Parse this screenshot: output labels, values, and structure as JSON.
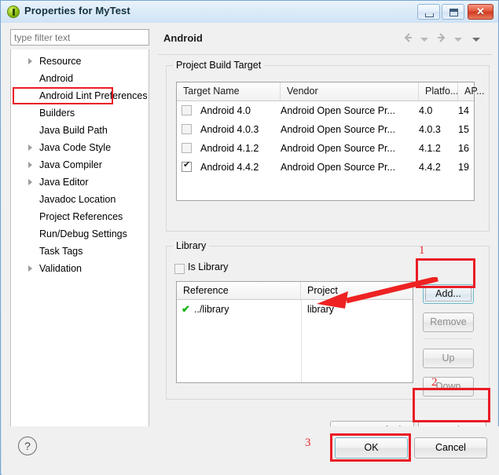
{
  "window": {
    "title": "Properties for MyTest",
    "icon": "eclipse-properties-icon",
    "controls": {
      "minimize": "minimize-icon",
      "maximize": "maximize-icon",
      "close": "✕"
    }
  },
  "sidebar": {
    "filter": {
      "placeholder": "type filter text",
      "value": ""
    },
    "items": [
      {
        "label": "Resource",
        "expandable": true
      },
      {
        "label": "Android",
        "expandable": false,
        "highlighted": true
      },
      {
        "label": "Android Lint Preferences",
        "expandable": false
      },
      {
        "label": "Builders",
        "expandable": false
      },
      {
        "label": "Java Build Path",
        "expandable": false
      },
      {
        "label": "Java Code Style",
        "expandable": true
      },
      {
        "label": "Java Compiler",
        "expandable": true
      },
      {
        "label": "Java Editor",
        "expandable": true
      },
      {
        "label": "Javadoc Location",
        "expandable": false
      },
      {
        "label": "Project References",
        "expandable": false
      },
      {
        "label": "Run/Debug Settings",
        "expandable": false
      },
      {
        "label": "Task Tags",
        "expandable": false
      },
      {
        "label": "Validation",
        "expandable": true
      }
    ]
  },
  "content": {
    "page_title": "Android",
    "nav_icons": [
      "back-arrow-icon",
      "back-dropdown-caret-icon",
      "forward-arrow-icon",
      "forward-dropdown-caret-icon",
      "view-menu-caret-icon"
    ],
    "build_target": {
      "group_label": "Project Build Target",
      "columns": [
        "Target Name",
        "Vendor",
        "Platfo...",
        "AP..."
      ],
      "rows": [
        {
          "checked": false,
          "name": "Android 4.0",
          "vendor": "Android Open Source Pr...",
          "platform": "4.0",
          "api": "14"
        },
        {
          "checked": false,
          "name": "Android 4.0.3",
          "vendor": "Android Open Source Pr...",
          "platform": "4.0.3",
          "api": "15"
        },
        {
          "checked": false,
          "name": "Android 4.1.2",
          "vendor": "Android Open Source Pr...",
          "platform": "4.1.2",
          "api": "16"
        },
        {
          "checked": true,
          "name": "Android 4.4.2",
          "vendor": "Android Open Source Pr...",
          "platform": "4.4.2",
          "api": "19"
        }
      ]
    },
    "library": {
      "group_label": "Library",
      "is_library_label": "Is Library",
      "is_library_checked": false,
      "columns": [
        "Reference",
        "Project"
      ],
      "rows": [
        {
          "status": "✔",
          "reference": "../library",
          "project": "library"
        }
      ],
      "buttons": {
        "add": "Add...",
        "remove": "Remove",
        "up": "Up",
        "down": "Down"
      }
    },
    "restore_defaults": "Restore Defaults",
    "apply": "Apply"
  },
  "footer": {
    "help": "?",
    "ok": "OK",
    "cancel": "Cancel"
  },
  "annotations": {
    "step_1": "1",
    "step_2": "2",
    "step_3": "3",
    "highlight_color": "#ea1c25",
    "arrow": "red-pointer-arrow"
  }
}
